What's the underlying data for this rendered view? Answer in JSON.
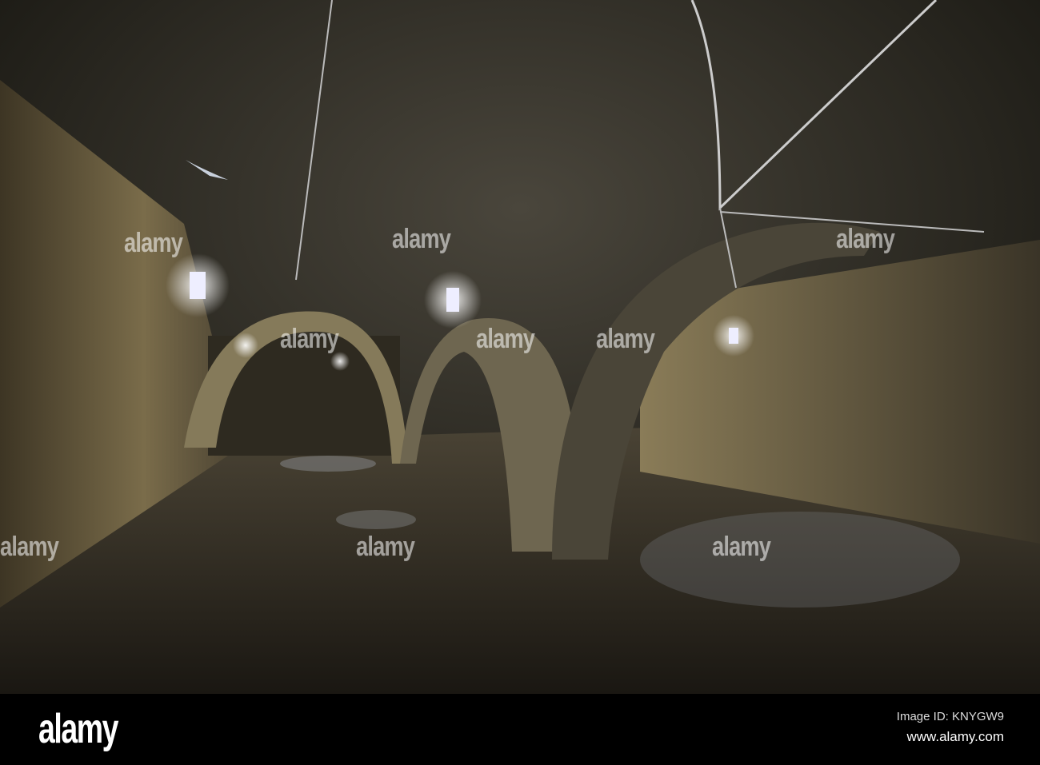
{
  "photo": {
    "subject": "stone vaulted cellar with arches and lanterns"
  },
  "watermarks": [
    "alamy",
    "alamy",
    "alamy",
    "alamy",
    "alamy",
    "alamy",
    "alamy",
    "alamy",
    "alamy"
  ],
  "footer": {
    "logo": "alamy",
    "image_id": "Image ID: KNYGW9",
    "website": "www.alamy.com"
  }
}
